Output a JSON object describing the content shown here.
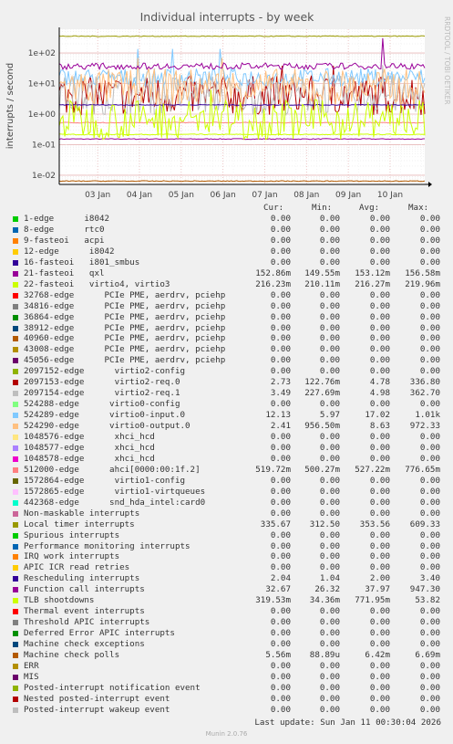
{
  "chart_data": {
    "type": "line",
    "title": "Individual interrupts - by week",
    "ylabel": "interrupts / second",
    "side_label": "RRDTOOL / TOBI OETIKER",
    "yscale": "log",
    "ylim": [
      0.005,
      600
    ],
    "yticks": [
      "1e+02",
      "1e+01",
      "1e+00",
      "1e-01",
      "1e-02"
    ],
    "x_ticks": [
      "03 Jan",
      "04 Jan",
      "05 Jan",
      "06 Jan",
      "07 Jan",
      "08 Jan",
      "09 Jan",
      "10 Jan"
    ],
    "grid": true,
    "columns": [
      "Cur:",
      "Min:",
      "Avg:",
      "Max:"
    ],
    "series": [
      {
        "name": "1-edge      i8042",
        "color": "#00cc00",
        "cur": "0.00",
        "min": "0.00",
        "avg": "0.00",
        "max": "0.00"
      },
      {
        "name": "8-edge      rtc0",
        "color": "#0066b3",
        "cur": "0.00",
        "min": "0.00",
        "avg": "0.00",
        "max": "0.00"
      },
      {
        "name": "9-fasteoi   acpi",
        "color": "#ff8000",
        "cur": "0.00",
        "min": "0.00",
        "avg": "0.00",
        "max": "0.00"
      },
      {
        "name": "12-edge      i8042",
        "color": "#ffcc00",
        "cur": "0.00",
        "min": "0.00",
        "avg": "0.00",
        "max": "0.00"
      },
      {
        "name": "16-fasteoi   i801_smbus",
        "color": "#330099",
        "cur": "0.00",
        "min": "0.00",
        "avg": "0.00",
        "max": "0.00"
      },
      {
        "name": "21-fasteoi   qxl",
        "color": "#990099",
        "cur": "152.86m",
        "min": "149.55m",
        "avg": "153.12m",
        "max": "156.58m"
      },
      {
        "name": "22-fasteoi   virtio4, virtio3",
        "color": "#ccff00",
        "cur": "216.23m",
        "min": "210.11m",
        "avg": "216.27m",
        "max": "219.96m"
      },
      {
        "name": "32768-edge      PCIe PME, aerdrv, pciehp",
        "color": "#ff0000",
        "cur": "0.00",
        "min": "0.00",
        "avg": "0.00",
        "max": "0.00"
      },
      {
        "name": "34816-edge      PCIe PME, aerdrv, pciehp",
        "color": "#808080",
        "cur": "0.00",
        "min": "0.00",
        "avg": "0.00",
        "max": "0.00"
      },
      {
        "name": "36864-edge      PCIe PME, aerdrv, pciehp",
        "color": "#008f00",
        "cur": "0.00",
        "min": "0.00",
        "avg": "0.00",
        "max": "0.00"
      },
      {
        "name": "38912-edge      PCIe PME, aerdrv, pciehp",
        "color": "#00487d",
        "cur": "0.00",
        "min": "0.00",
        "avg": "0.00",
        "max": "0.00"
      },
      {
        "name": "40960-edge      PCIe PME, aerdrv, pciehp",
        "color": "#b35a00",
        "cur": "0.00",
        "min": "0.00",
        "avg": "0.00",
        "max": "0.00"
      },
      {
        "name": "43008-edge      PCIe PME, aerdrv, pciehp",
        "color": "#b38f00",
        "cur": "0.00",
        "min": "0.00",
        "avg": "0.00",
        "max": "0.00"
      },
      {
        "name": "45056-edge      PCIe PME, aerdrv, pciehp",
        "color": "#6b006b",
        "cur": "0.00",
        "min": "0.00",
        "avg": "0.00",
        "max": "0.00"
      },
      {
        "name": "2097152-edge      virtio2-config",
        "color": "#8fb300",
        "cur": "0.00",
        "min": "0.00",
        "avg": "0.00",
        "max": "0.00"
      },
      {
        "name": "2097153-edge      virtio2-req.0",
        "color": "#b30000",
        "cur": "2.73",
        "min": "122.76m",
        "avg": "4.78",
        "max": "336.80"
      },
      {
        "name": "2097154-edge      virtio2-req.1",
        "color": "#bebebe",
        "cur": "3.49",
        "min": "227.69m",
        "avg": "4.98",
        "max": "362.70"
      },
      {
        "name": "524288-edge      virtio0-config",
        "color": "#80ff80",
        "cur": "0.00",
        "min": "0.00",
        "avg": "0.00",
        "max": "0.00"
      },
      {
        "name": "524289-edge      virtio0-input.0",
        "color": "#80c9ff",
        "cur": "12.13",
        "min": "5.97",
        "avg": "17.02",
        "max": "1.01k"
      },
      {
        "name": "524290-edge      virtio0-output.0",
        "color": "#ffc080",
        "cur": "2.41",
        "min": "956.50m",
        "avg": "8.63",
        "max": "972.33"
      },
      {
        "name": "1048576-edge      xhci_hcd",
        "color": "#ffe680",
        "cur": "0.00",
        "min": "0.00",
        "avg": "0.00",
        "max": "0.00"
      },
      {
        "name": "1048577-edge      xhci_hcd",
        "color": "#aa80ff",
        "cur": "0.00",
        "min": "0.00",
        "avg": "0.00",
        "max": "0.00"
      },
      {
        "name": "1048578-edge      xhci_hcd",
        "color": "#ee00cc",
        "cur": "0.00",
        "min": "0.00",
        "avg": "0.00",
        "max": "0.00"
      },
      {
        "name": "512000-edge      ahci[0000:00:1f.2]",
        "color": "#ff8080",
        "cur": "519.72m",
        "min": "500.27m",
        "avg": "527.22m",
        "max": "776.65m"
      },
      {
        "name": "1572864-edge      virtio1-config",
        "color": "#666600",
        "cur": "0.00",
        "min": "0.00",
        "avg": "0.00",
        "max": "0.00"
      },
      {
        "name": "1572865-edge      virtio1-virtqueues",
        "color": "#ffbfff",
        "cur": "0.00",
        "min": "0.00",
        "avg": "0.00",
        "max": "0.00"
      },
      {
        "name": "442368-edge      snd_hda_intel:card0",
        "color": "#00ffcc",
        "cur": "0.00",
        "min": "0.00",
        "avg": "0.00",
        "max": "0.00"
      },
      {
        "name": "Non-maskable interrupts",
        "color": "#cc6699",
        "cur": "0.00",
        "min": "0.00",
        "avg": "0.00",
        "max": "0.00"
      },
      {
        "name": "Local timer interrupts",
        "color": "#999900",
        "cur": "335.67",
        "min": "312.50",
        "avg": "353.56",
        "max": "609.33"
      },
      {
        "name": "Spurious interrupts",
        "color": "#00cc00",
        "cur": "0.00",
        "min": "0.00",
        "avg": "0.00",
        "max": "0.00"
      },
      {
        "name": "Performance monitoring interrupts",
        "color": "#0066b3",
        "cur": "0.00",
        "min": "0.00",
        "avg": "0.00",
        "max": "0.00"
      },
      {
        "name": "IRQ work interrupts",
        "color": "#ff8000",
        "cur": "0.00",
        "min": "0.00",
        "avg": "0.00",
        "max": "0.00"
      },
      {
        "name": "APIC ICR read retries",
        "color": "#ffcc00",
        "cur": "0.00",
        "min": "0.00",
        "avg": "0.00",
        "max": "0.00"
      },
      {
        "name": "Rescheduling interrupts",
        "color": "#330099",
        "cur": "2.04",
        "min": "1.04",
        "avg": "2.00",
        "max": "3.40"
      },
      {
        "name": "Function call interrupts",
        "color": "#990099",
        "cur": "32.67",
        "min": "26.32",
        "avg": "37.97",
        "max": "947.30"
      },
      {
        "name": "TLB shootdowns",
        "color": "#ccff00",
        "cur": "319.53m",
        "min": "34.36m",
        "avg": "771.95m",
        "max": "53.82"
      },
      {
        "name": "Thermal event interrupts",
        "color": "#ff0000",
        "cur": "0.00",
        "min": "0.00",
        "avg": "0.00",
        "max": "0.00"
      },
      {
        "name": "Threshold APIC interrupts",
        "color": "#808080",
        "cur": "0.00",
        "min": "0.00",
        "avg": "0.00",
        "max": "0.00"
      },
      {
        "name": "Deferred Error APIC interrupts",
        "color": "#008f00",
        "cur": "0.00",
        "min": "0.00",
        "avg": "0.00",
        "max": "0.00"
      },
      {
        "name": "Machine check exceptions",
        "color": "#00487d",
        "cur": "0.00",
        "min": "0.00",
        "avg": "0.00",
        "max": "0.00"
      },
      {
        "name": "Machine check polls",
        "color": "#b35a00",
        "cur": "5.56m",
        "min": "88.89u",
        "avg": "6.42m",
        "max": "6.69m"
      },
      {
        "name": "ERR",
        "color": "#b38f00",
        "cur": "0.00",
        "min": "0.00",
        "avg": "0.00",
        "max": "0.00"
      },
      {
        "name": "MIS",
        "color": "#6b006b",
        "cur": "0.00",
        "min": "0.00",
        "avg": "0.00",
        "max": "0.00"
      },
      {
        "name": "Posted-interrupt notification event",
        "color": "#8fb300",
        "cur": "0.00",
        "min": "0.00",
        "avg": "0.00",
        "max": "0.00"
      },
      {
        "name": "Nested posted-interrupt event",
        "color": "#b30000",
        "cur": "0.00",
        "min": "0.00",
        "avg": "0.00",
        "max": "0.00"
      },
      {
        "name": "Posted-interrupt wakeup event",
        "color": "#bebebe",
        "cur": "0.00",
        "min": "0.00",
        "avg": "0.00",
        "max": "0.00"
      }
    ]
  },
  "footer": {
    "last_update": "Last update: Sun Jan 11 00:30:04 2026",
    "munin_version": "Munin 2.0.76"
  }
}
